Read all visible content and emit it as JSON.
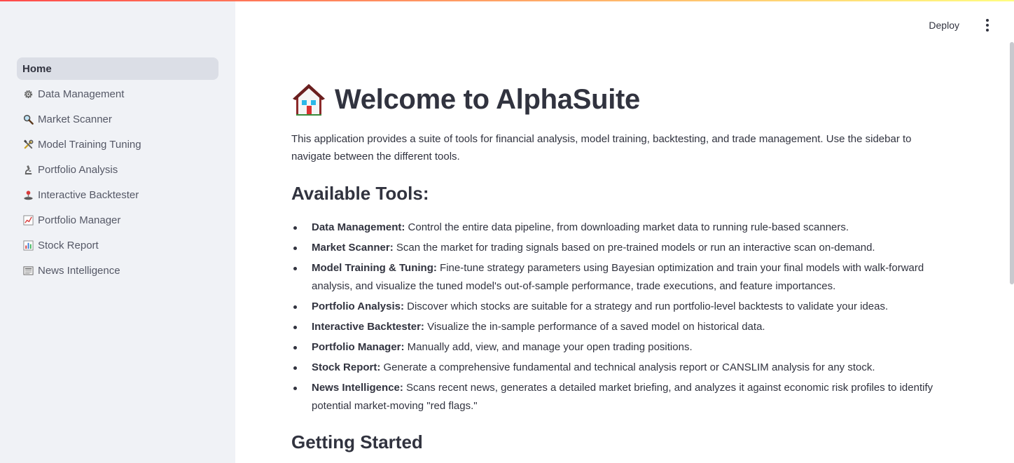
{
  "header": {
    "deploy_label": "Deploy",
    "menu_icon": "kebab-menu-icon"
  },
  "sidebar": {
    "items": [
      {
        "label": "Home",
        "icon": "",
        "active": true
      },
      {
        "label": "Data Management",
        "icon": "gear-icon",
        "active": false
      },
      {
        "label": "Market Scanner",
        "icon": "magnifier-icon",
        "active": false
      },
      {
        "label": "Model Training Tuning",
        "icon": "tools-icon",
        "active": false
      },
      {
        "label": "Portfolio Analysis",
        "icon": "microscope-icon",
        "active": false
      },
      {
        "label": "Interactive Backtester",
        "icon": "joystick-icon",
        "active": false
      },
      {
        "label": "Portfolio Manager",
        "icon": "trend-chart-icon",
        "active": false
      },
      {
        "label": "Stock Report",
        "icon": "bar-chart-icon",
        "active": false
      },
      {
        "label": "News Intelligence",
        "icon": "newspaper-icon",
        "active": false
      }
    ]
  },
  "main": {
    "title": "Welcome to AlphaSuite",
    "title_icon": "house-icon",
    "intro": "This application provides a suite of tools for financial analysis, model training, backtesting, and trade management. Use the sidebar to navigate between the different tools.",
    "tools_heading": "Available Tools:",
    "tools": [
      {
        "name": "Data Management:",
        "desc": " Control the entire data pipeline, from downloading market data to running rule-based scanners."
      },
      {
        "name": "Market Scanner:",
        "desc": " Scan the market for trading signals based on pre-trained models or run an interactive scan on-demand."
      },
      {
        "name": "Model Training & Tuning:",
        "desc": " Fine-tune strategy parameters using Bayesian optimization and train your final models with walk-forward analysis, and visualize the tuned model's out-of-sample performance, trade executions, and feature importances."
      },
      {
        "name": "Portfolio Analysis:",
        "desc": " Discover which stocks are suitable for a strategy and run portfolio-level backtests to validate your ideas."
      },
      {
        "name": "Interactive Backtester:",
        "desc": " Visualize the in-sample performance of a saved model on historical data."
      },
      {
        "name": "Portfolio Manager:",
        "desc": " Manually add, view, and manage your open trading positions."
      },
      {
        "name": "Stock Report:",
        "desc": " Generate a comprehensive fundamental and technical analysis report or CANSLIM analysis for any stock."
      },
      {
        "name": "News Intelligence:",
        "desc": " Scans recent news, generates a detailed market briefing, and analyzes it against economic risk profiles to identify potential market-moving \"red flags.\""
      }
    ],
    "started_heading": "Getting Started"
  },
  "colors": {
    "sidebar_bg": "#f0f2f6",
    "active_item_bg": "#dbdee6",
    "text": "#31333f",
    "decoration_start": "#ff4b4b",
    "decoration_end": "#fffd80"
  }
}
